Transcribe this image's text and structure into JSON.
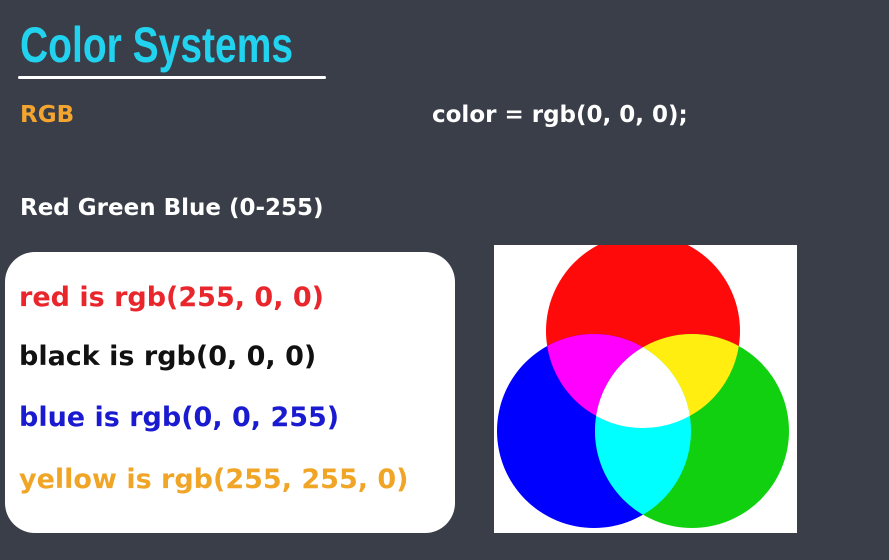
{
  "slide": {
    "title": "Color Systems",
    "subtitle": "RGB",
    "code_example": "color = rgb(0, 0, 0);",
    "description": "Red Green Blue (0-255)"
  },
  "examples": [
    {
      "text": "red is rgb(255, 0, 0)",
      "color": "#e8262b"
    },
    {
      "text": "black is rgb(0, 0, 0)",
      "color": "#111111"
    },
    {
      "text": "blue is rgb(0, 0, 255)",
      "color": "#1a1ad0"
    },
    {
      "text": "yellow is rgb(255, 255, 0)",
      "color": "#f0a526"
    }
  ],
  "colors": {
    "background": "#393e48",
    "title": "#22d3f0",
    "accent": "#f3a530",
    "red": "#ff0a0a",
    "green": "#10d010",
    "blue": "#0000ff",
    "magenta": "#ff00ff",
    "yellow": "#ffee10",
    "cyan": "#00ffff",
    "white": "#ffffff"
  }
}
